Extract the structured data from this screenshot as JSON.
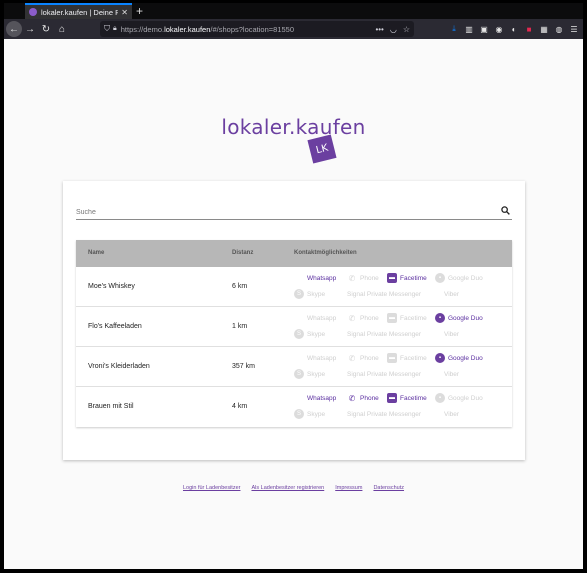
{
  "browser": {
    "tab_title": "lokaler.kaufen | Deine Pl...",
    "url_prefix": "https://demo.",
    "url_domain": "lokaler.kaufen",
    "url_path": "/#/shops?location=81550"
  },
  "brand": {
    "name": "lokaler.kaufen",
    "logo_text": "LK"
  },
  "search": {
    "placeholder": "Suche"
  },
  "table": {
    "headers": {
      "name": "Name",
      "distance": "Distanz",
      "contacts": "Kontaktmöglichkeiten"
    },
    "contact_labels": [
      "Whatsapp",
      "Phone",
      "Facetime",
      "Google Duo",
      "Skype",
      "Signal Private Messenger",
      "Viber"
    ],
    "rows": [
      {
        "name": "Moe's Whiskey",
        "distance": "6 km",
        "enabled": [
          true,
          false,
          true,
          false,
          false,
          false,
          false
        ]
      },
      {
        "name": "Flo's Kaffeeladen",
        "distance": "1 km",
        "enabled": [
          false,
          false,
          false,
          true,
          false,
          false,
          false
        ]
      },
      {
        "name": "Vroni's Kleiderladen",
        "distance": "357 km",
        "enabled": [
          false,
          false,
          false,
          true,
          false,
          false,
          false
        ]
      },
      {
        "name": "Brauen mit Stil",
        "distance": "4 km",
        "enabled": [
          true,
          true,
          true,
          false,
          false,
          false,
          false
        ]
      }
    ]
  },
  "footer": {
    "links": [
      "Login für Ladenbesitzer",
      "Als Ladenbesitzer registrieren",
      "Impressum",
      "Datenschutz"
    ]
  },
  "colors": {
    "accent": "#6b3fa0",
    "disabled": "#cfcfcf",
    "header_bg": "#b7b7b7"
  },
  "icons": [
    "whatsapp-icon",
    "phone-icon",
    "facetime-icon",
    "google-duo-icon",
    "skype-icon",
    "signal-icon",
    "viber-icon"
  ]
}
